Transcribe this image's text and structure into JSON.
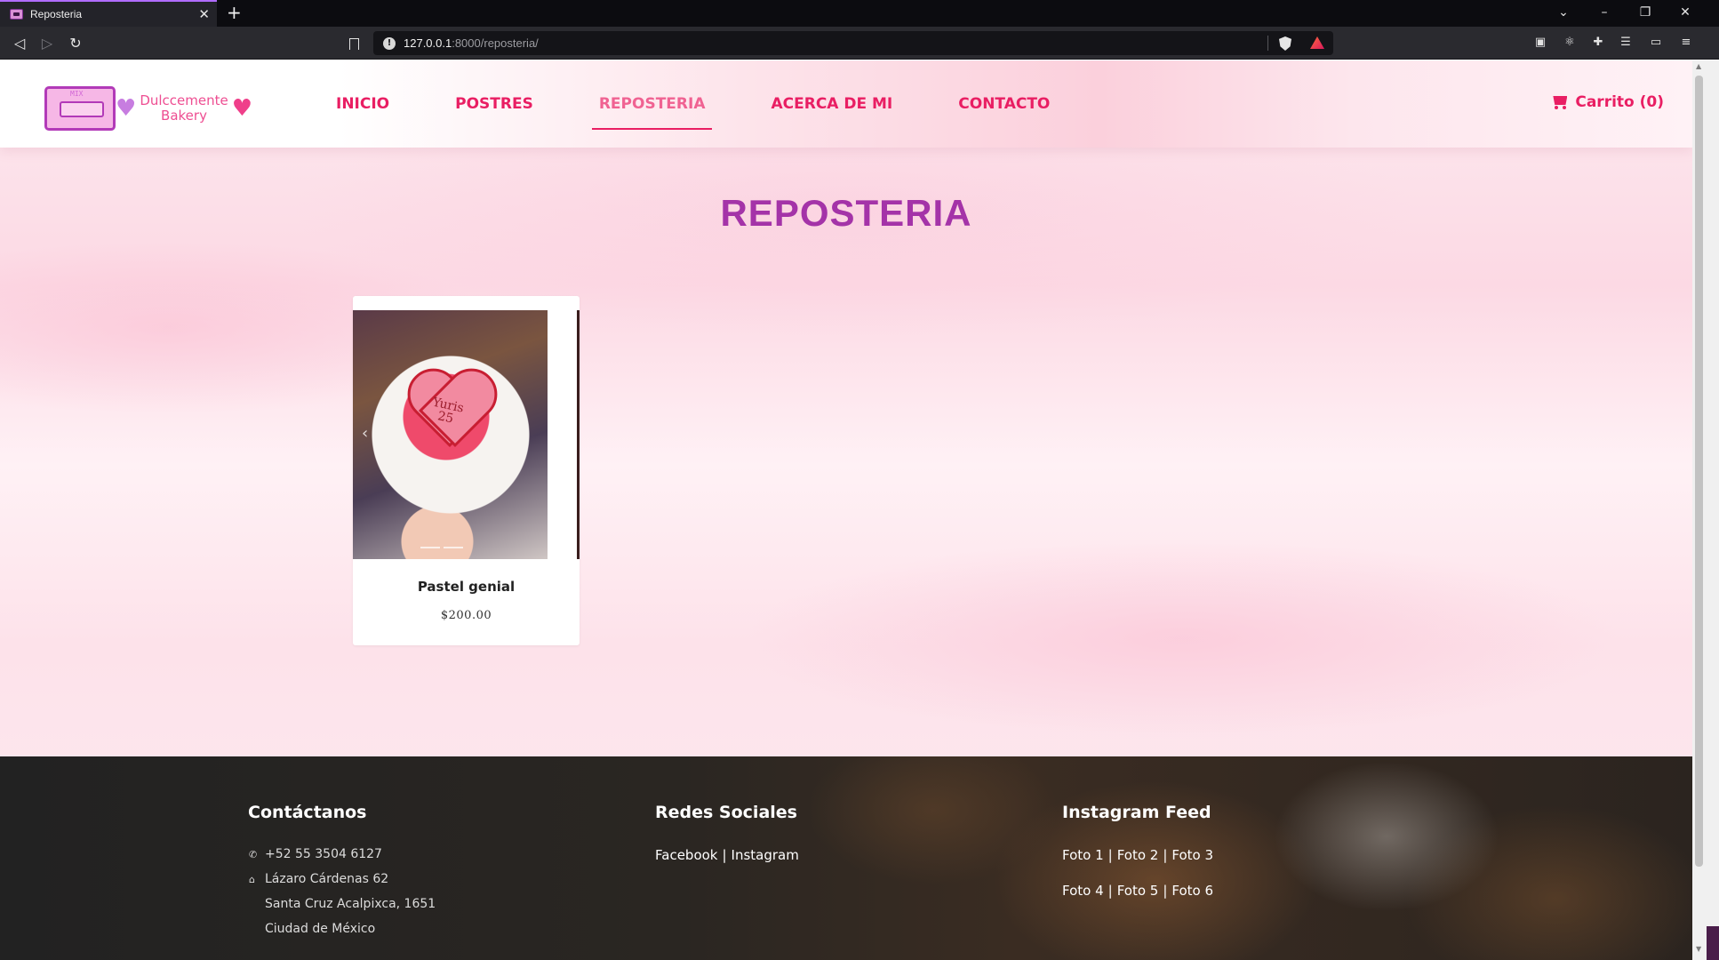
{
  "browser": {
    "tab_title": "Reposteria",
    "url_host": "127.0.0.1",
    "url_rest": ":8000/reposteria/"
  },
  "header": {
    "logo_line1": "Dulccemente",
    "logo_line2": "Bakery",
    "nav": [
      {
        "label": "INICIO"
      },
      {
        "label": "POSTRES"
      },
      {
        "label": "REPOSTERIA",
        "active": true
      },
      {
        "label": "ACERCA DE MI"
      },
      {
        "label": "CONTACTO"
      }
    ],
    "cart_label": "Carrito (0)"
  },
  "main": {
    "title": "REPOSTERIA",
    "products": [
      {
        "name": "Pastel genial",
        "price": "$200.00",
        "cake_text_1": "Yuris",
        "cake_text_2": "25"
      }
    ]
  },
  "footer": {
    "contact": {
      "heading": "Contáctanos",
      "phone": "+52 55 3504 6127",
      "address_1": "Lázaro Cárdenas 62",
      "address_2": "Santa Cruz Acalpixca, 1651",
      "address_3": "Ciudad de México"
    },
    "social": {
      "heading": "Redes Sociales",
      "links": [
        "Facebook",
        "Instagram"
      ]
    },
    "instagram": {
      "heading": "Instagram Feed",
      "row1": [
        "Foto 1",
        "Foto 2",
        "Foto 3"
      ],
      "row2": [
        "Foto 4",
        "Foto 5",
        "Foto 6"
      ]
    }
  },
  "colors": {
    "brand_pink": "#e91e63",
    "title_purple": "#a433a8"
  }
}
